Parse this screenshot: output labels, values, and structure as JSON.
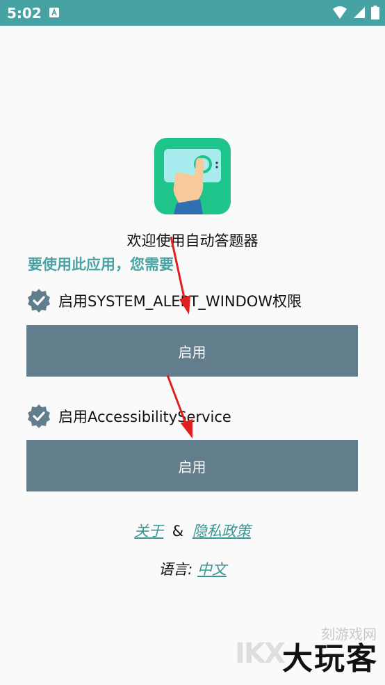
{
  "status_bar": {
    "time": "5:02"
  },
  "welcome": "欢迎使用自动答题器",
  "requirement": "要使用此应用，您需要",
  "permissions": [
    {
      "label": "启用SYSTEM_ALERT_WINDOW权限",
      "button": "启用"
    },
    {
      "label": "启用AccessibilityService",
      "button": "启用"
    }
  ],
  "links": {
    "about": "关于",
    "separator": "&",
    "privacy": "隐私政策"
  },
  "language": {
    "label": "语言:",
    "value": "中文"
  },
  "watermark": {
    "main": "大玩客",
    "small": "刻游戏网",
    "logo": "IKX"
  },
  "colors": {
    "status_bar": "#47a3a3",
    "button": "#627d8b",
    "accent": "#4aa3a3",
    "icon_bg": "#1fc48a"
  }
}
